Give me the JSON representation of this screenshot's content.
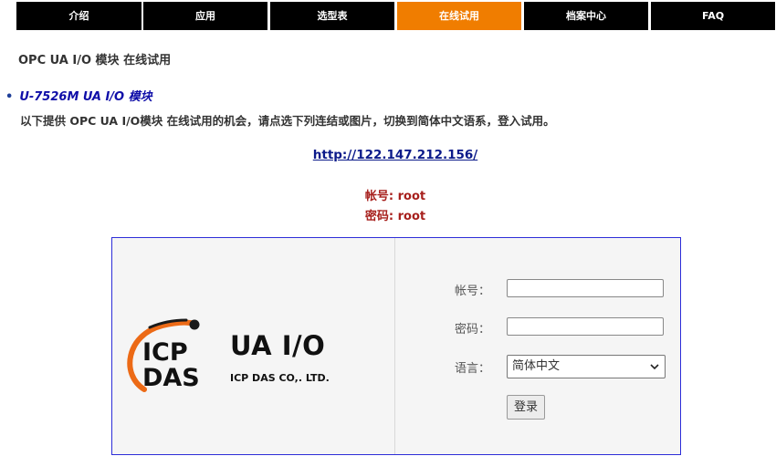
{
  "nav": {
    "tabs": [
      {
        "label": "介绍"
      },
      {
        "label": "应用"
      },
      {
        "label": "选型表"
      },
      {
        "label": "在线试用"
      },
      {
        "label": "档案中心"
      },
      {
        "label": "FAQ"
      }
    ],
    "active_index": 3
  },
  "page": {
    "title": "OPC UA I/O 模块 在线试用",
    "product_link": "U-7526M UA I/O 模块",
    "description": "以下提供 OPC UA I/O模块 在线试用的机会，请点选下列连结或图片，切换到简体中文语系，登入试用。",
    "demo_url": "http://122.147.212.156/",
    "username_line": "帐号: root",
    "password_line": "密码: root"
  },
  "login_screenshot": {
    "logo": {
      "icp": "ICP",
      "das": "DAS",
      "product": "UA I/O",
      "company": "ICP DAS CO,. LTD."
    },
    "form": {
      "username_label": "帐号：",
      "password_label": "密码：",
      "language_label": "语言：",
      "language_selected": "简体中文",
      "login_button": "登录"
    }
  },
  "colors": {
    "nav_bg": "#000000",
    "nav_active": "#f07d00",
    "credential_red": "#a7201d",
    "link_blue": "#0f0ea8",
    "frame_border": "#2d2dd8",
    "logo_orange": "#ec6a16"
  }
}
